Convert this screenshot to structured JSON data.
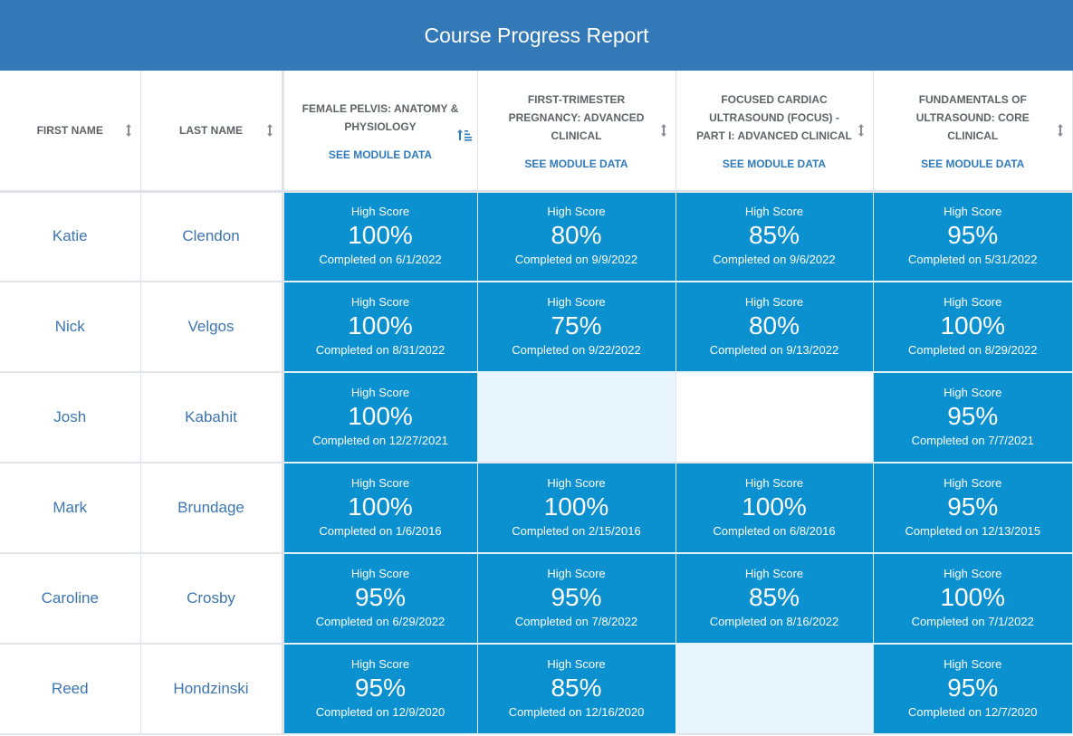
{
  "header": {
    "title": "Course Progress Report",
    "background_color": "#3379b7"
  },
  "colors": {
    "score_cell": "#0b90d0",
    "empty_cell_tint": "#e9f5fd",
    "name_text": "#3d75b0",
    "link_text": "#2f7bbd",
    "header_text": "#5f6268"
  },
  "columns": {
    "first_name": {
      "label": "FIRST NAME",
      "sort_icon": "sort-both-icon"
    },
    "last_name": {
      "label": "LAST NAME",
      "sort_icon": "sort-both-icon"
    },
    "modules": [
      {
        "label": "FEMALE PELVIS: ANATOMY & PHYSIOLOGY",
        "link": "SEE MODULE DATA",
        "sort_icon": "sort-ascending-icon"
      },
      {
        "label": "FIRST-TRIMESTER PREGNANCY: ADVANCED CLINICAL",
        "link": "SEE MODULE DATA",
        "sort_icon": "sort-both-icon"
      },
      {
        "label": "FOCUSED CARDIAC ULTRASOUND (FOCUS) - PART I: ADVANCED CLINICAL",
        "link": "SEE MODULE DATA",
        "sort_icon": "sort-both-icon"
      },
      {
        "label": "FUNDAMENTALS OF ULTRASOUND: CORE CLINICAL",
        "link": "SEE MODULE DATA",
        "sort_icon": "sort-both-icon"
      }
    ]
  },
  "rows": [
    {
      "first": "Katie",
      "last": "Clendon",
      "cells": [
        {
          "label": "High Score",
          "score": "100%",
          "date": "Completed on 6/1/2022"
        },
        {
          "label": "High Score",
          "score": "80%",
          "date": "Completed on 9/9/2022"
        },
        {
          "label": "High Score",
          "score": "85%",
          "date": "Completed on 9/6/2022"
        },
        {
          "label": "High Score",
          "score": "95%",
          "date": "Completed on 5/31/2022"
        }
      ]
    },
    {
      "first": "Nick",
      "last": "Velgos",
      "cells": [
        {
          "label": "High Score",
          "score": "100%",
          "date": "Completed on 8/31/2022"
        },
        {
          "label": "High Score",
          "score": "75%",
          "date": "Completed on 9/22/2022"
        },
        {
          "label": "High Score",
          "score": "80%",
          "date": "Completed on 9/13/2022"
        },
        {
          "label": "High Score",
          "score": "100%",
          "date": "Completed on 8/29/2022"
        }
      ]
    },
    {
      "first": "Josh",
      "last": "Kabahit",
      "cells": [
        {
          "label": "High Score",
          "score": "100%",
          "date": "Completed on 12/27/2021"
        },
        {
          "empty": "tint"
        },
        {
          "empty": "white"
        },
        {
          "label": "High Score",
          "score": "95%",
          "date": "Completed on 7/7/2021"
        }
      ]
    },
    {
      "first": "Mark",
      "last": "Brundage",
      "cells": [
        {
          "label": "High Score",
          "score": "100%",
          "date": "Completed on 1/6/2016"
        },
        {
          "label": "High Score",
          "score": "100%",
          "date": "Completed on 2/15/2016"
        },
        {
          "label": "High Score",
          "score": "100%",
          "date": "Completed on 6/8/2016"
        },
        {
          "label": "High Score",
          "score": "95%",
          "date": "Completed on 12/13/2015"
        }
      ]
    },
    {
      "first": "Caroline",
      "last": "Crosby",
      "cells": [
        {
          "label": "High Score",
          "score": "95%",
          "date": "Completed on 6/29/2022"
        },
        {
          "label": "High Score",
          "score": "95%",
          "date": "Completed on 7/8/2022"
        },
        {
          "label": "High Score",
          "score": "85%",
          "date": "Completed on 8/16/2022"
        },
        {
          "label": "High Score",
          "score": "100%",
          "date": "Completed on 7/1/2022"
        }
      ]
    },
    {
      "first": "Reed",
      "last": "Hondzinski",
      "cells": [
        {
          "label": "High Score",
          "score": "95%",
          "date": "Completed on 12/9/2020"
        },
        {
          "label": "High Score",
          "score": "85%",
          "date": "Completed on 12/16/2020"
        },
        {
          "empty": "tint"
        },
        {
          "label": "High Score",
          "score": "95%",
          "date": "Completed on 12/7/2020"
        }
      ]
    }
  ]
}
